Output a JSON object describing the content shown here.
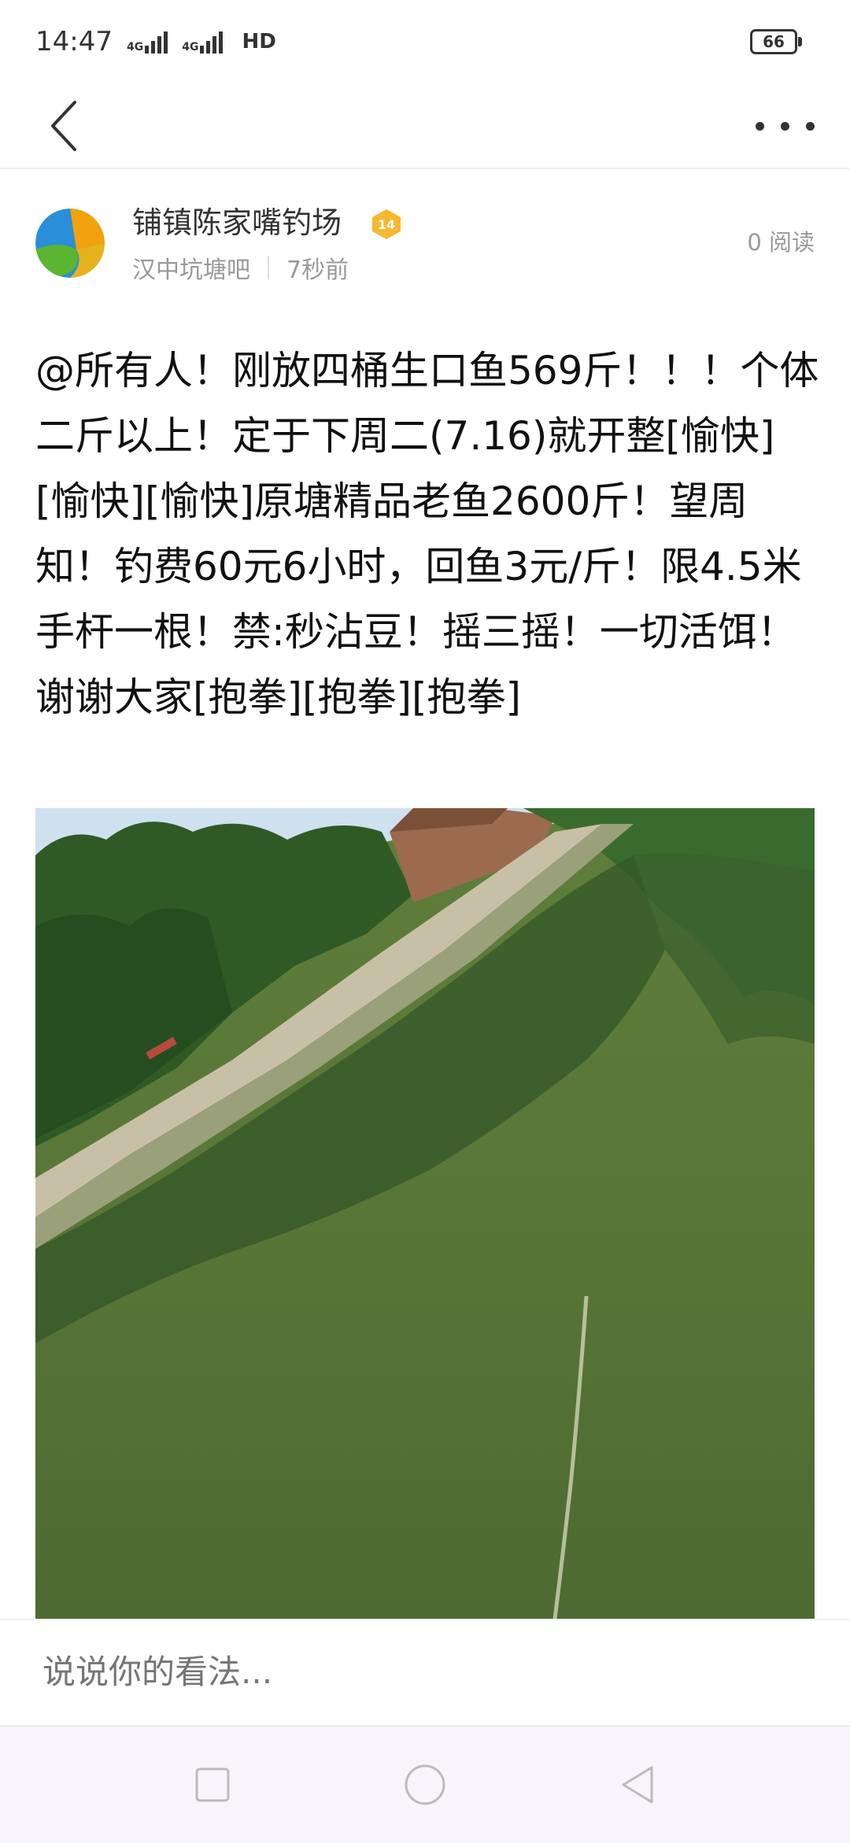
{
  "status_bar": {
    "time": "14:47",
    "network_1": "4G",
    "network_2": "4G",
    "hd": "HD",
    "battery": "66"
  },
  "nav": {
    "back_icon": "chevron-left-icon",
    "more_icon": "more-horizontal-icon"
  },
  "post": {
    "author": "铺镇陈家嘴钓场",
    "level": "14",
    "forum": "汉中坑塘吧",
    "time_ago": "7秒前",
    "read_count": "0 阅读",
    "text": "@所有人！刚放四桶生口鱼569斤！！！个体二斤以上！定于下周二(7.16)就开整[愉快][愉快][愉快]原塘精品老鱼2600斤！望周知！钓费60元6小时，回鱼3元/斤！限4.5米手杆一根！禁:秒沾豆！摇三摇！一切活饵！谢谢大家[抱拳][抱拳][抱拳]"
  },
  "comment": {
    "placeholder": "说说你的看法..."
  },
  "system_nav": {
    "recents_icon": "square-icon",
    "home_icon": "circle-icon",
    "back_icon": "triangle-back-icon"
  },
  "colors": {
    "badge": "#f5b82e",
    "water": "#5b7a35",
    "sky": "#cfe0ef"
  }
}
